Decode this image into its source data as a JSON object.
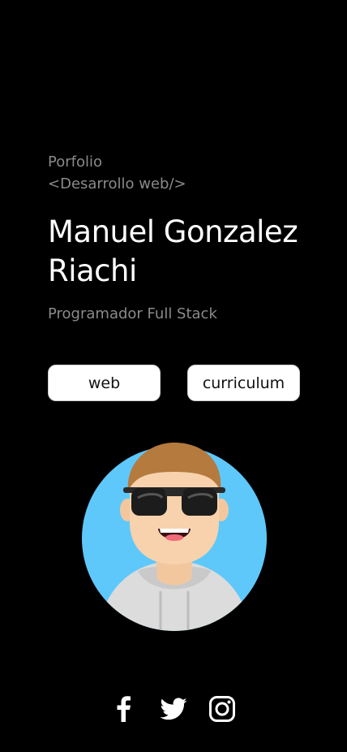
{
  "hero": {
    "eyebrow_line1": "Porfolio",
    "eyebrow_line2": "<Desarrollo web/>",
    "name_line1": "Manuel Gonzalez",
    "name_line2": "Riachi",
    "role": "Programador Full Stack"
  },
  "buttons": {
    "web": "web",
    "curriculum": "curriculum"
  },
  "avatar": {
    "icon": "memoji-avatar",
    "bg_color": "#5ec8fb"
  },
  "social": [
    {
      "icon": "facebook-icon"
    },
    {
      "icon": "twitter-icon"
    },
    {
      "icon": "instagram-icon"
    }
  ]
}
